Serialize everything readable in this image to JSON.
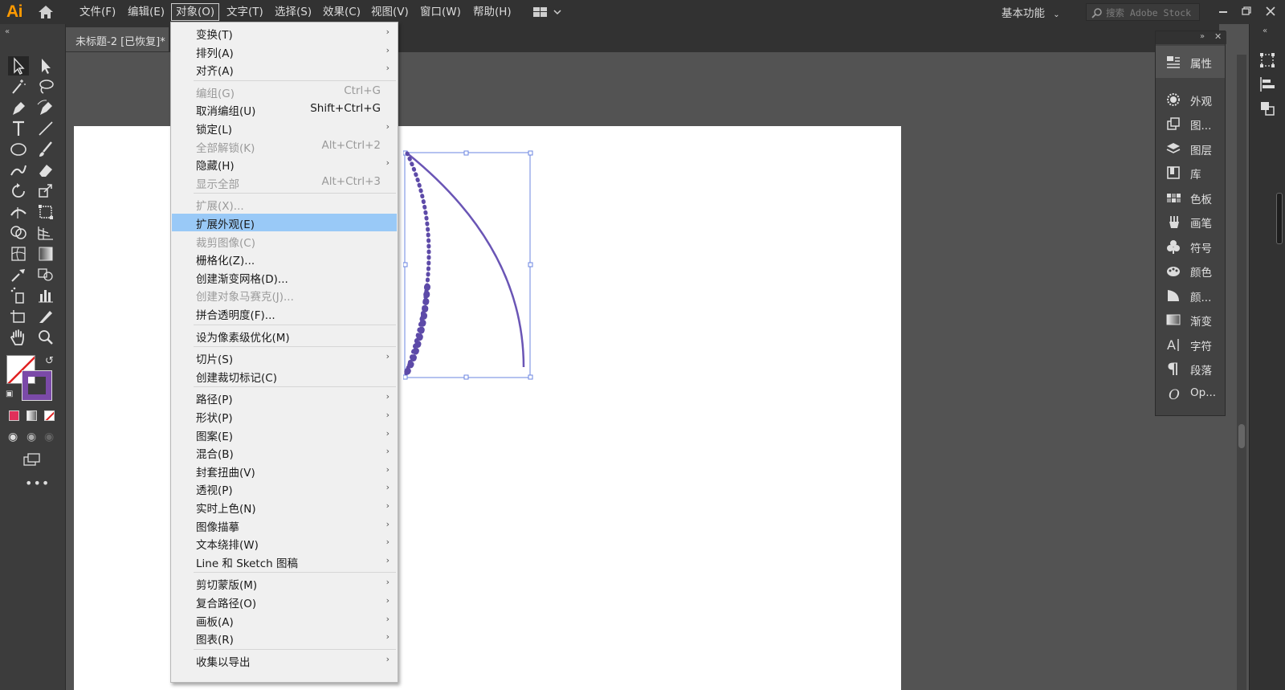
{
  "app": {
    "logo": "Ai",
    "menus": [
      "文件(F)",
      "编辑(E)",
      "对象(O)",
      "文字(T)",
      "选择(S)",
      "效果(C)",
      "视图(V)",
      "窗口(W)",
      "帮助(H)"
    ],
    "workspace": "基本功能",
    "search_placeholder": "搜索 Adobe Stock"
  },
  "document": {
    "tab_title": "未标题-2 [已恢复]*"
  },
  "colors": {
    "accent": "#ff9a00",
    "stroke_purple": "#6a55b5",
    "highlight": "#99c9f7",
    "fill_purple": "#7b4aa8"
  },
  "object_menu": {
    "items": [
      {
        "label": "变换(T)",
        "shortcut": "",
        "submenu": true,
        "disabled": false
      },
      {
        "label": "排列(A)",
        "shortcut": "",
        "submenu": true,
        "disabled": false
      },
      {
        "label": "对齐(A)",
        "shortcut": "",
        "submenu": true,
        "disabled": false
      },
      {
        "label": "编组(G)",
        "shortcut": "Ctrl+G",
        "submenu": false,
        "disabled": true
      },
      {
        "label": "取消编组(U)",
        "shortcut": "Shift+Ctrl+G",
        "submenu": false,
        "disabled": false
      },
      {
        "label": "锁定(L)",
        "shortcut": "",
        "submenu": true,
        "disabled": false
      },
      {
        "label": "全部解锁(K)",
        "shortcut": "Alt+Ctrl+2",
        "submenu": false,
        "disabled": true
      },
      {
        "label": "隐藏(H)",
        "shortcut": "",
        "submenu": true,
        "disabled": false
      },
      {
        "label": "显示全部",
        "shortcut": "Alt+Ctrl+3",
        "submenu": false,
        "disabled": true
      },
      {
        "label": "扩展(X)...",
        "shortcut": "",
        "submenu": false,
        "disabled": true
      },
      {
        "label": "扩展外观(E)",
        "shortcut": "",
        "submenu": false,
        "disabled": false,
        "highlighted": true
      },
      {
        "label": "裁剪图像(C)",
        "shortcut": "",
        "submenu": false,
        "disabled": true
      },
      {
        "label": "栅格化(Z)...",
        "shortcut": "",
        "submenu": false,
        "disabled": false
      },
      {
        "label": "创建渐变网格(D)...",
        "shortcut": "",
        "submenu": false,
        "disabled": false
      },
      {
        "label": "创建对象马赛克(J)...",
        "shortcut": "",
        "submenu": false,
        "disabled": true
      },
      {
        "label": "拼合透明度(F)...",
        "shortcut": "",
        "submenu": false,
        "disabled": false
      },
      {
        "label": "设为像素级优化(M)",
        "shortcut": "",
        "submenu": false,
        "disabled": false
      },
      {
        "label": "切片(S)",
        "shortcut": "",
        "submenu": true,
        "disabled": false
      },
      {
        "label": "创建裁切标记(C)",
        "shortcut": "",
        "submenu": false,
        "disabled": false
      },
      {
        "label": "路径(P)",
        "shortcut": "",
        "submenu": true,
        "disabled": false
      },
      {
        "label": "形状(P)",
        "shortcut": "",
        "submenu": true,
        "disabled": false
      },
      {
        "label": "图案(E)",
        "shortcut": "",
        "submenu": true,
        "disabled": false
      },
      {
        "label": "混合(B)",
        "shortcut": "",
        "submenu": true,
        "disabled": false
      },
      {
        "label": "封套扭曲(V)",
        "shortcut": "",
        "submenu": true,
        "disabled": false
      },
      {
        "label": "透视(P)",
        "shortcut": "",
        "submenu": true,
        "disabled": false
      },
      {
        "label": "实时上色(N)",
        "shortcut": "",
        "submenu": true,
        "disabled": false
      },
      {
        "label": "图像描摹",
        "shortcut": "",
        "submenu": true,
        "disabled": false
      },
      {
        "label": "文本绕排(W)",
        "shortcut": "",
        "submenu": true,
        "disabled": false
      },
      {
        "label": "Line 和 Sketch 图稿",
        "shortcut": "",
        "submenu": true,
        "disabled": false
      },
      {
        "label": "剪切蒙版(M)",
        "shortcut": "",
        "submenu": true,
        "disabled": false
      },
      {
        "label": "复合路径(O)",
        "shortcut": "",
        "submenu": true,
        "disabled": false
      },
      {
        "label": "画板(A)",
        "shortcut": "",
        "submenu": true,
        "disabled": false
      },
      {
        "label": "图表(R)",
        "shortcut": "",
        "submenu": true,
        "disabled": false
      },
      {
        "label": "收集以导出",
        "shortcut": "",
        "submenu": true,
        "disabled": false
      }
    ]
  },
  "right_panel": {
    "items": [
      {
        "label": "属性",
        "icon": "properties-icon"
      },
      {
        "label": "外观",
        "icon": "appearance-icon"
      },
      {
        "label": "图...",
        "icon": "graphic-styles-icon"
      },
      {
        "label": "图层",
        "icon": "layers-icon"
      },
      {
        "label": "库",
        "icon": "libraries-icon"
      },
      {
        "label": "色板",
        "icon": "swatches-icon"
      },
      {
        "label": "画笔",
        "icon": "brushes-icon"
      },
      {
        "label": "符号",
        "icon": "symbols-icon"
      },
      {
        "label": "颜色",
        "icon": "color-icon"
      },
      {
        "label": "颜...",
        "icon": "color-guide-icon"
      },
      {
        "label": "渐变",
        "icon": "gradient-icon"
      },
      {
        "label": "字符",
        "icon": "character-icon"
      },
      {
        "label": "段落",
        "icon": "paragraph-icon"
      },
      {
        "label": "Op...",
        "icon": "opentype-icon"
      }
    ]
  }
}
